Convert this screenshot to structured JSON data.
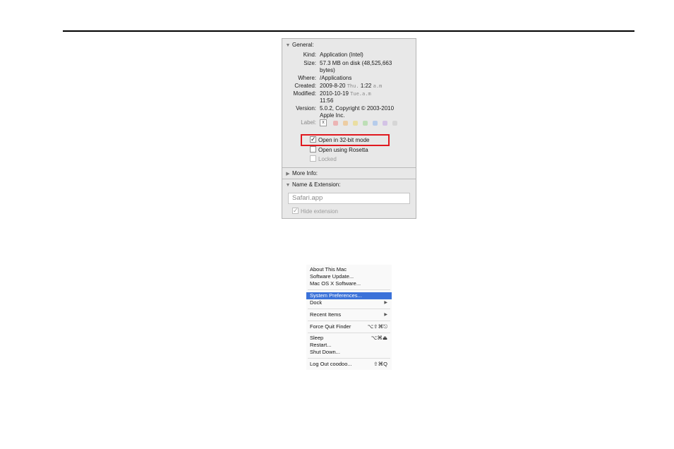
{
  "info_panel": {
    "general": {
      "header": "General:",
      "fields": [
        {
          "key": "Kind:",
          "value": "Application (Intel)"
        },
        {
          "key": "Size:",
          "value": "57.3 MB on disk (48,525,663",
          "value2": "bytes)"
        },
        {
          "key": "Where:",
          "value": "/Applications"
        },
        {
          "key": "Created:",
          "value": "2009-8-20",
          "dim": "Thu.",
          "value_tail": "1:22",
          "dim2": "a.m"
        },
        {
          "key": "Modified:",
          "value": "2010-10-19",
          "dim": "Tue.a.m",
          "value2": "11:56"
        },
        {
          "key": "Version:",
          "value": "5.0.2, Copyright © 2003-2010",
          "value2": "Apple Inc."
        }
      ],
      "label_key": "Label:",
      "label_x": "x",
      "label_colors": [
        "#f08a8a",
        "#f2b86c",
        "#ecd76a",
        "#9bd68f",
        "#8fb6ef",
        "#c3a5e3",
        "#c9c9c9"
      ],
      "checkboxes": [
        {
          "label": "Open in 32-bit mode",
          "checked": true
        },
        {
          "label": "Open using Rosetta",
          "checked": false
        },
        {
          "label": "Locked",
          "checked": false
        }
      ]
    },
    "more_info": {
      "header": "More Info:"
    },
    "name_ext": {
      "header": "Name & Extension:",
      "filename": "Safari.app",
      "hide_extension": "Hide extension",
      "check_mark": "✓"
    },
    "highlight_color": "#e0191f"
  },
  "apple_menu": {
    "items": [
      {
        "label": "About This Mac"
      },
      {
        "label": "Software Update..."
      },
      {
        "label": "Mac OS X Software..."
      },
      {
        "label": "System Preferences..."
      },
      {
        "label": "Dock",
        "submenu": "▶"
      },
      {
        "label": "Recent Items",
        "submenu": "▶"
      },
      {
        "label": "Force Quit Finder",
        "shortcut": "⌥⇧⌘⎋"
      },
      {
        "label": "Sleep",
        "shortcut": "⌥⌘⏏"
      },
      {
        "label": "Restart..."
      },
      {
        "label": "Shut Down..."
      },
      {
        "label": "Log Out coodoo...",
        "shortcut": "⇧⌘Q"
      }
    ],
    "selected_color": "#3b72d9"
  }
}
